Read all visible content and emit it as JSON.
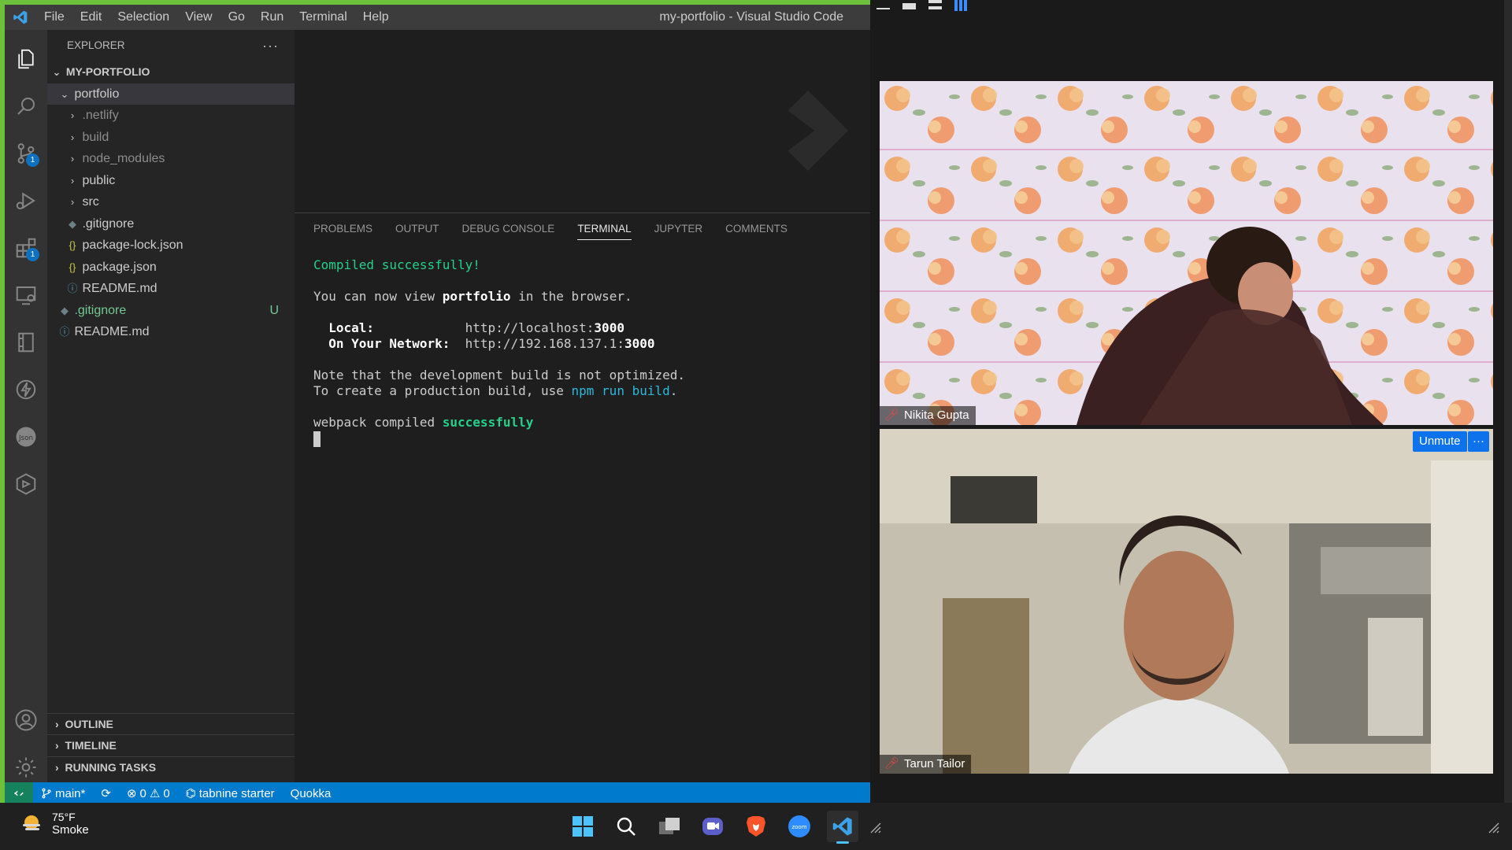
{
  "vscode": {
    "menu": [
      "File",
      "Edit",
      "Selection",
      "View",
      "Go",
      "Run",
      "Terminal",
      "Help"
    ],
    "window_title": "my-portfolio - Visual Studio Code",
    "activity_badges": {
      "source_control": "1",
      "extensions": "1"
    },
    "explorer": {
      "header": "EXPLORER",
      "more": "···",
      "root": "MY-PORTFOLIO",
      "folder": "portfolio",
      "items": [
        ".netlify",
        "build",
        "node_modules",
        "public",
        "src",
        ".gitignore",
        "package-lock.json",
        "package.json",
        "README.md"
      ],
      "root_files": [
        ".gitignore",
        "README.md"
      ],
      "untracked_marker": "U"
    },
    "sections": [
      "OUTLINE",
      "TIMELINE",
      "RUNNING TASKS"
    ],
    "panel_tabs": [
      "PROBLEMS",
      "OUTPUT",
      "DEBUG CONSOLE",
      "TERMINAL",
      "JUPYTER",
      "COMMENTS"
    ],
    "terminal": {
      "compiled": "Compiled successfully!",
      "view_prefix": "You can now view ",
      "app_name": "portfolio",
      "view_suffix": " in the browser.",
      "local_label": "Local:",
      "local_url": "http://localhost:",
      "local_port": "3000",
      "network_label": "On Your Network:",
      "network_url": "http://192.168.137.1:",
      "network_port": "3000",
      "note1": "Note that the development build is not optimized.",
      "note2_prefix": "To create a production build, use ",
      "note2_cmd": "npm run build",
      "note2_suffix": ".",
      "webpack_prefix": "webpack compiled ",
      "webpack_status": "successfully"
    },
    "status": {
      "branch": "main*",
      "errors": "0",
      "warnings": "0",
      "tabnine": "tabnine starter",
      "quokka": "Quokka"
    }
  },
  "zoom": {
    "participant1": "Nikita Gupta",
    "participant2": "Tarun Tailor",
    "unmute": "Unmute",
    "more": "···"
  },
  "taskbar": {
    "temperature": "75°F",
    "condition": "Smoke"
  },
  "colors": {
    "accent_status": "#007acc",
    "terminal_green": "#23d18b",
    "terminal_cyan": "#29b8db",
    "zoom_blue": "#0e72ed"
  }
}
